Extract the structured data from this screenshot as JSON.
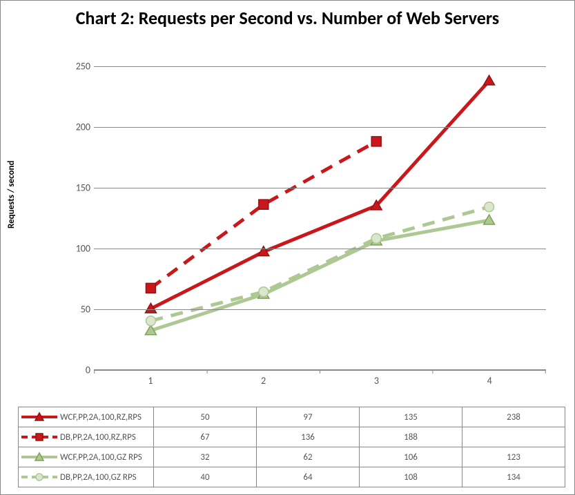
{
  "chart_data": {
    "type": "line",
    "title": "Chart 2: Requests per Second vs. Number of Web Servers",
    "xlabel": "",
    "ylabel": "Requests / second",
    "categories": [
      "1",
      "2",
      "3",
      "4"
    ],
    "ylim": [
      0,
      250
    ],
    "yticks": [
      0,
      50,
      100,
      150,
      200,
      250
    ],
    "series": [
      {
        "name": "WCF,PP,2A,100,RZ,RPS",
        "values": [
          50,
          97,
          135,
          238
        ],
        "color": "#c8181b",
        "style": "solid",
        "marker": "triangle"
      },
      {
        "name": "DB,PP,2A,100,RZ,RPS",
        "values": [
          67,
          136,
          188,
          null
        ],
        "color": "#c8181b",
        "style": "dashed",
        "marker": "square"
      },
      {
        "name": "WCF,PP,2A,100,GZ RPS",
        "values": [
          32,
          62,
          106,
          123
        ],
        "color": "#aec893",
        "style": "solid",
        "marker": "triangle"
      },
      {
        "name": "DB,PP,2A,100,GZ RPS",
        "values": [
          40,
          64,
          108,
          134
        ],
        "color": "#aec893",
        "style": "dashed",
        "marker": "circle"
      }
    ]
  }
}
